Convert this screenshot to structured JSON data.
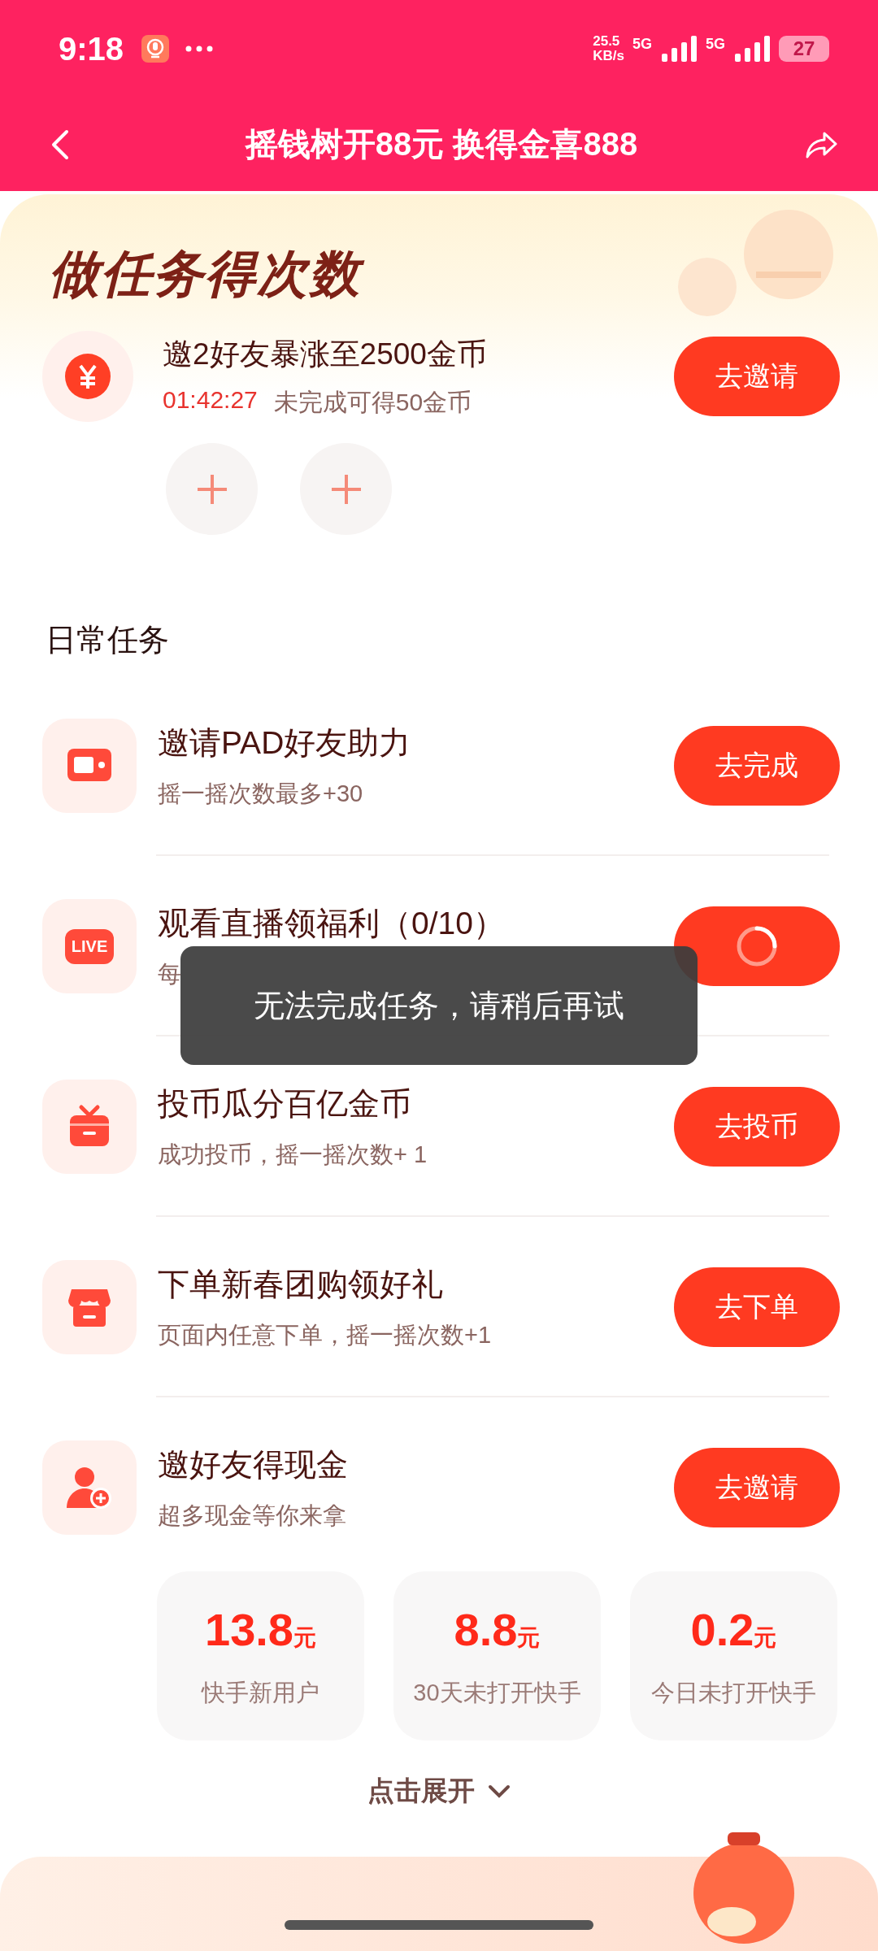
{
  "status_bar": {
    "time": "9:18",
    "speed": "25.5",
    "speed_unit": "KB/s",
    "network_1": "5G",
    "network_2": "5G",
    "battery": "27"
  },
  "nav": {
    "title": "摇钱树开88元 换得金喜888"
  },
  "task_section": {
    "heading": "做任务得次数",
    "featured": {
      "title": "邀2好友暴涨至2500金币",
      "countdown": "01:42:27",
      "note": "未完成可得50金币",
      "button": "去邀请",
      "invite_slots": [
        {
          "kind": "empty"
        },
        {
          "kind": "empty"
        }
      ]
    }
  },
  "daily": {
    "heading": "日常任务",
    "tasks": [
      {
        "kind": "tv",
        "title": "邀请PAD好友助力",
        "subtitle": "摇一摇次数最多+30",
        "button": {
          "kind": "label",
          "label": "去完成"
        }
      },
      {
        "kind": "live",
        "icon_label": "LIVE",
        "title": "观看直播领福利（0/10）",
        "subtitle": "每",
        "button": {
          "kind": "loading"
        }
      },
      {
        "kind": "gift",
        "title": "投币瓜分百亿金币",
        "subtitle": "成功投币，摇一摇次数+ 1",
        "button": {
          "kind": "label",
          "label": "去投币"
        }
      },
      {
        "kind": "shop",
        "title": "下单新春团购领好礼",
        "subtitle": "页面内任意下单，摇一摇次数+1",
        "button": {
          "kind": "label",
          "label": "去下单"
        }
      },
      {
        "kind": "add-user",
        "title": "邀好友得现金",
        "subtitle": "超多现金等你来拿",
        "button": {
          "kind": "label",
          "label": "去邀请"
        }
      }
    ],
    "rewards": [
      {
        "amount": "13.8",
        "unit": "元",
        "label": "快手新用户"
      },
      {
        "amount": "8.8",
        "unit": "元",
        "label": "30天未打开快手"
      },
      {
        "amount": "0.2",
        "unit": "元",
        "label": "今日未打开快手"
      }
    ],
    "expand": "点击展开"
  },
  "toast": {
    "text": "无法完成任务，请稍后再试"
  }
}
